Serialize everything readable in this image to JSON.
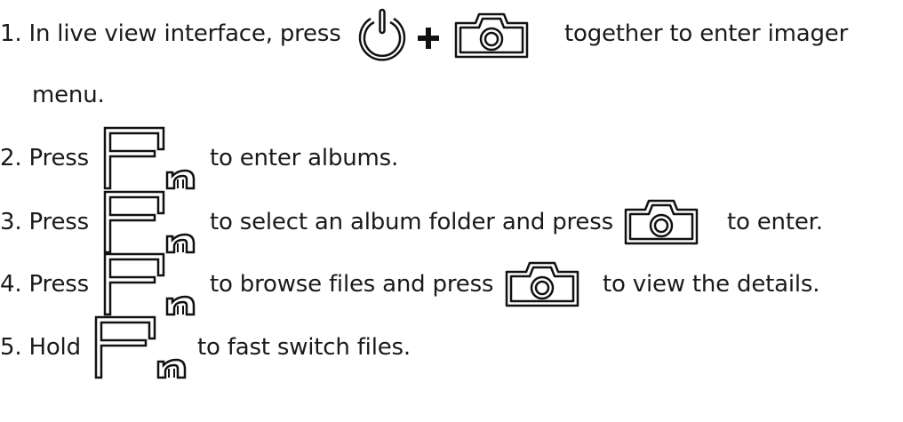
{
  "steps": [
    {
      "number": "1.",
      "text_before": "In live view interface, press",
      "icons": [
        "power-icon",
        "plus-icon",
        "camera-icon"
      ],
      "text_after": "together to enter imager",
      "continuation": "menu."
    },
    {
      "number": "2.",
      "text_before": "Press",
      "icons": [
        "fn-icon"
      ],
      "text_after": "to enter albums."
    },
    {
      "number": "3.",
      "text_before": "Press",
      "icons": [
        "fn-icon",
        "camera-icon"
      ],
      "text_middle": "to select an album folder and press",
      "text_after": "to enter."
    },
    {
      "number": "4.",
      "text_before": "Press",
      "icons": [
        "fn-icon",
        "camera-icon"
      ],
      "text_middle": "to browse files and press",
      "text_after": "to view the details."
    },
    {
      "number": "5.",
      "text_before": "Hold",
      "icons": [
        "fn-icon"
      ],
      "text_after": "to fast switch files."
    }
  ]
}
